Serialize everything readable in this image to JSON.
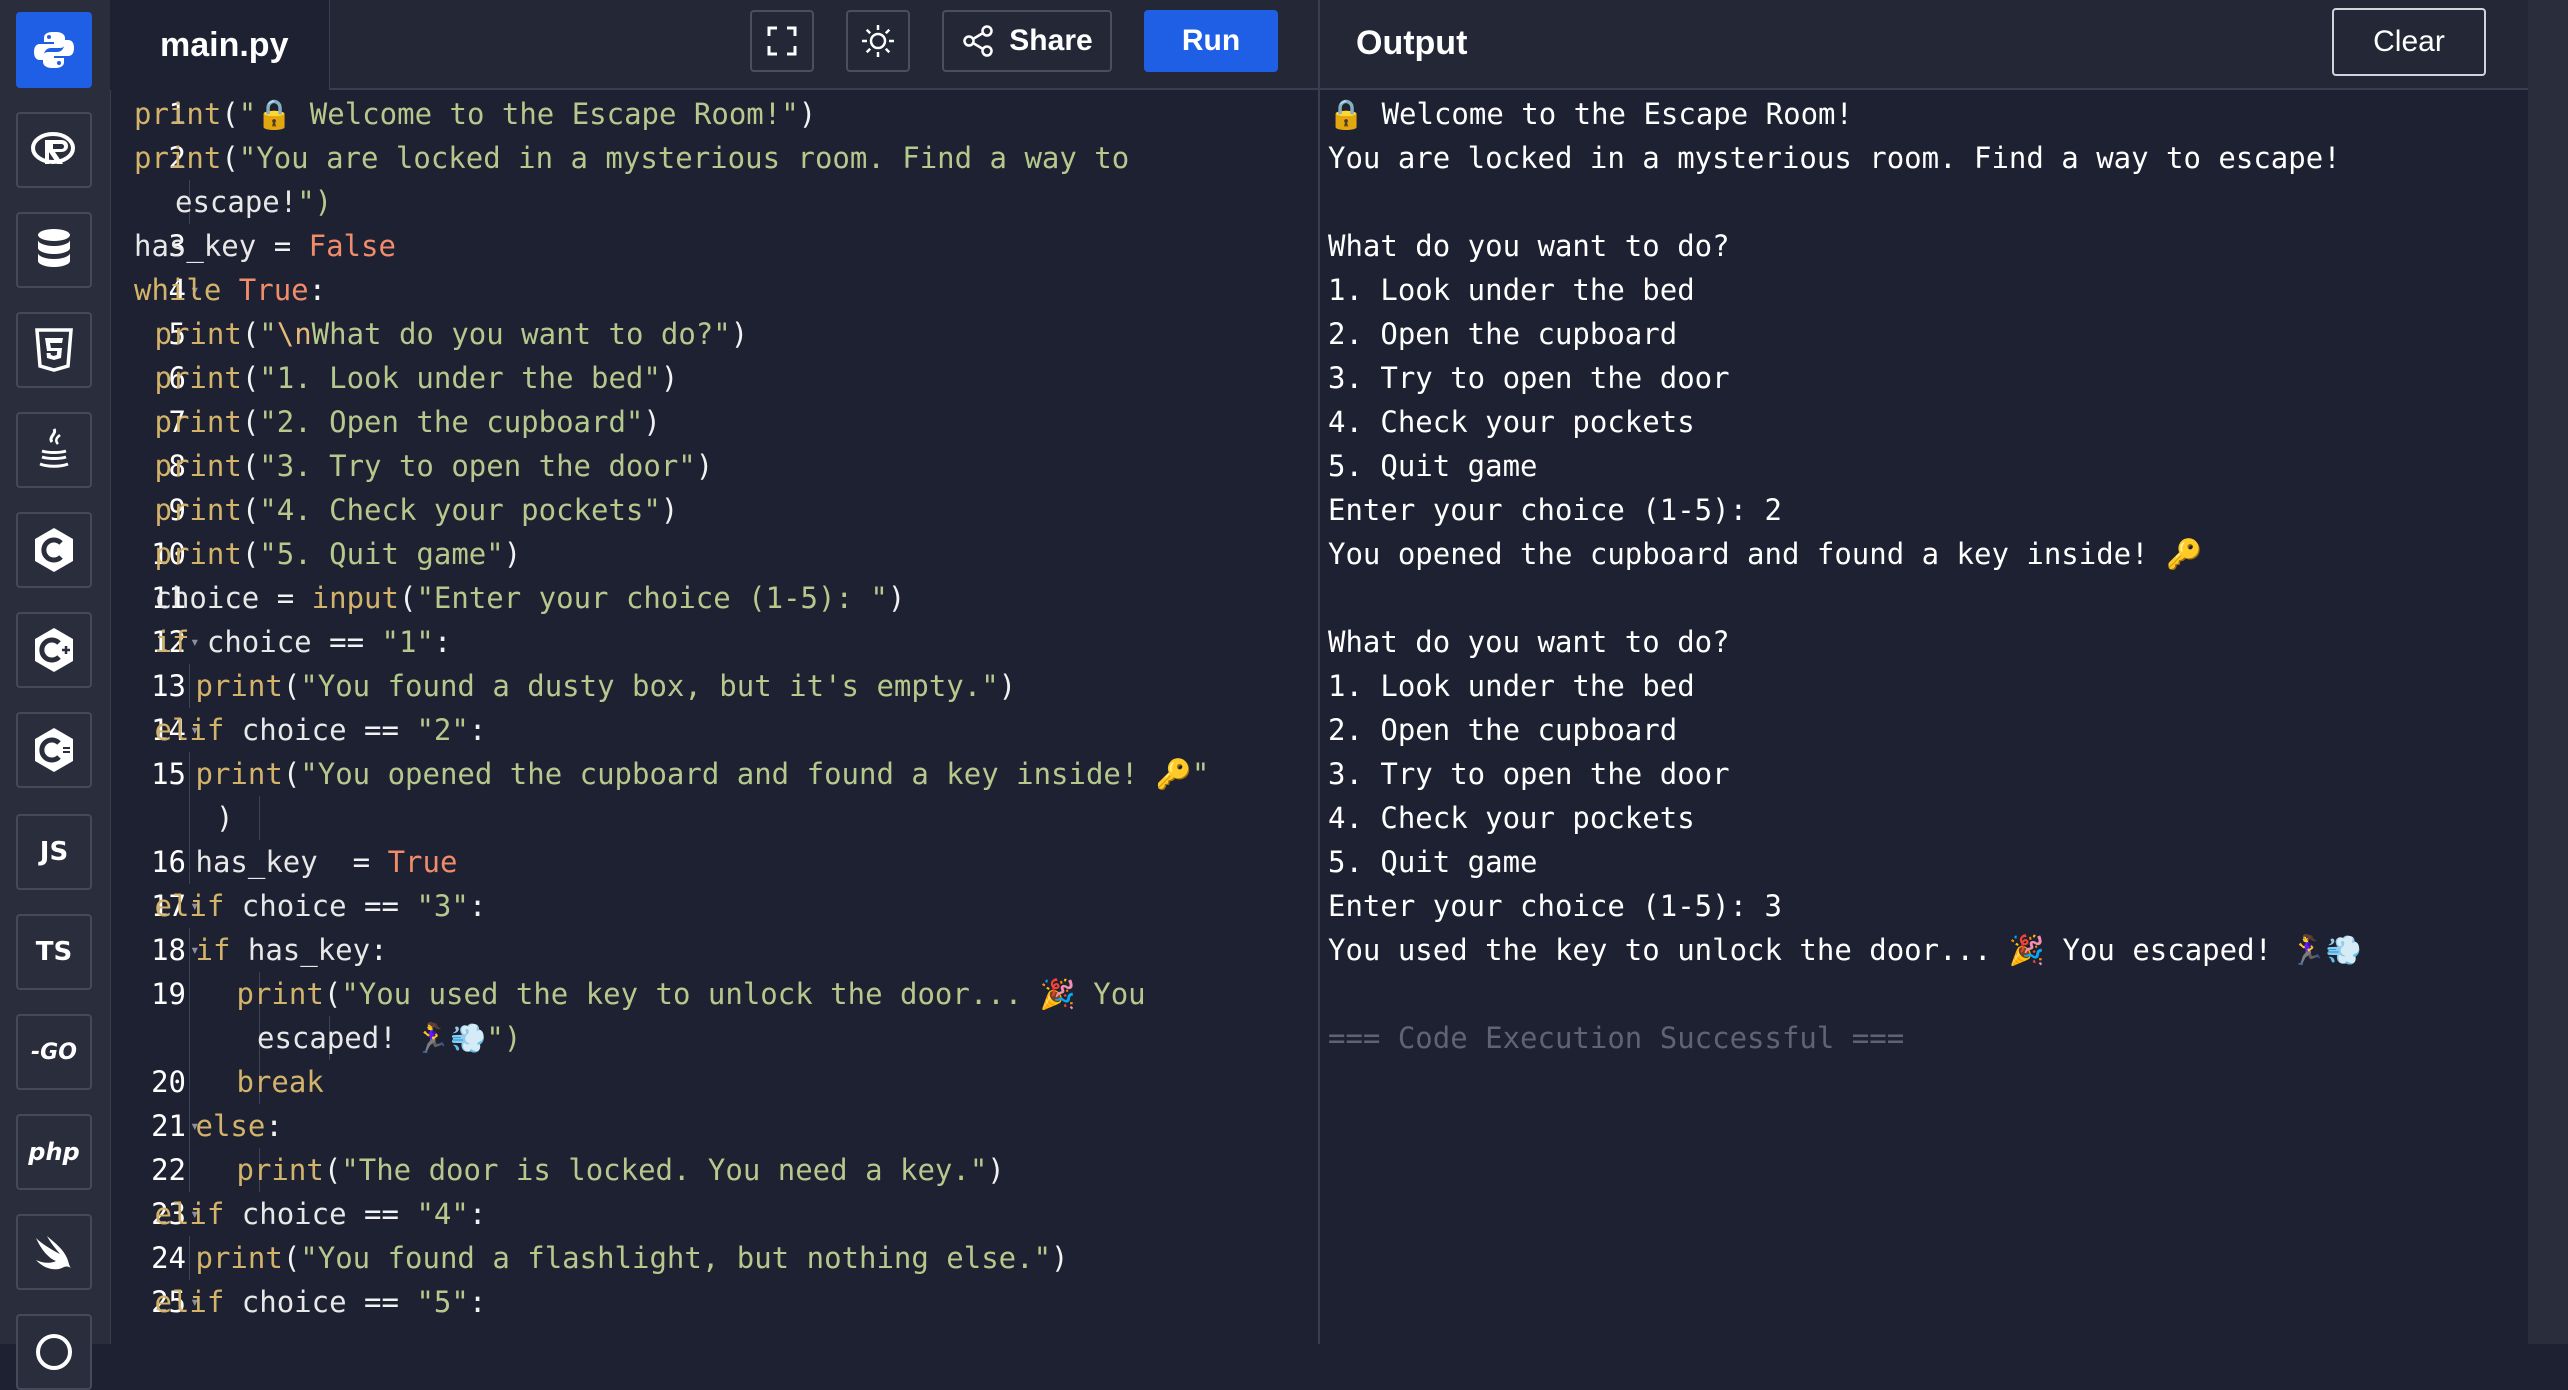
{
  "sidebar": {
    "items": [
      {
        "name": "python",
        "label": "",
        "icon": "python-icon"
      },
      {
        "name": "r",
        "label": "",
        "icon": "r-icon"
      },
      {
        "name": "sql",
        "label": "",
        "icon": "database-icon"
      },
      {
        "name": "html",
        "label": "",
        "icon": "html5-icon"
      },
      {
        "name": "java",
        "label": "",
        "icon": "java-icon"
      },
      {
        "name": "c",
        "label": "",
        "icon": "c-icon"
      },
      {
        "name": "cpp",
        "label": "",
        "icon": "cpp-icon"
      },
      {
        "name": "csharp",
        "label": "",
        "icon": "csharp-icon"
      },
      {
        "name": "js",
        "label": "JS",
        "icon": "js-icon"
      },
      {
        "name": "ts",
        "label": "TS",
        "icon": "ts-icon"
      },
      {
        "name": "go",
        "label": "-GO",
        "icon": "go-icon"
      },
      {
        "name": "php",
        "label": "php",
        "icon": "php-icon"
      },
      {
        "name": "swift",
        "label": "",
        "icon": "swift-icon"
      },
      {
        "name": "rust",
        "label": "",
        "icon": "rust-icon"
      }
    ]
  },
  "editor": {
    "file_name": "main.py",
    "toolbar": {
      "share_label": "Share",
      "run_label": "Run"
    },
    "lines": [
      {
        "n": "1",
        "text": "print(\"🔒 Welcome to the Escape Room!\")"
      },
      {
        "n": "2",
        "text": "print(\"You are locked in a mysterious room. Find a way to"
      },
      {
        "n": "",
        "text": "    escape!\")"
      },
      {
        "n": "3",
        "text": "has_key = False"
      },
      {
        "n": "4",
        "text": "while True:"
      },
      {
        "n": "5",
        "text": "  print(\"\\nWhat do you want to do?\")"
      },
      {
        "n": "6",
        "text": "  print(\"1. Look under the bed\")"
      },
      {
        "n": "7",
        "text": "  print(\"2. Open the cupboard\")"
      },
      {
        "n": "8",
        "text": "  print(\"3. Try to open the door\")"
      },
      {
        "n": "9",
        "text": "  print(\"4. Check your pockets\")"
      },
      {
        "n": "10",
        "text": "  print(\"5. Quit game\")"
      },
      {
        "n": "11",
        "text": "  choice = input(\"Enter your choice (1-5): \")"
      },
      {
        "n": "12",
        "text": "  if choice == \"1\":"
      },
      {
        "n": "13",
        "text": "      print(\"You found a dusty box, but it's empty.\")"
      },
      {
        "n": "14",
        "text": "  elif choice == \"2\":"
      },
      {
        "n": "15",
        "text": "      print(\"You opened the cupboard and found a key inside! 🔑\""
      },
      {
        "n": "",
        "text": "        )"
      },
      {
        "n": "16",
        "text": "      has_key  = True"
      },
      {
        "n": "17",
        "text": "  elif choice == \"3\":"
      },
      {
        "n": "18",
        "text": "      if has_key:"
      },
      {
        "n": "19",
        "text": "          print(\"You used the key to unlock the door... 🎉 You"
      },
      {
        "n": "",
        "text": "            escaped! 🏃‍♀️💨\")"
      },
      {
        "n": "20",
        "text": "          break"
      },
      {
        "n": "21",
        "text": "      else:"
      },
      {
        "n": "22",
        "text": "          print(\"The door is locked. You need a key.\")"
      },
      {
        "n": "23",
        "text": "  elif choice == \"4\":"
      },
      {
        "n": "24",
        "text": "      print(\"You found a flashlight, but nothing else.\")"
      },
      {
        "n": "25",
        "text": "  elif choice == \"5\":"
      }
    ]
  },
  "output": {
    "title": "Output",
    "clear_label": "Clear",
    "lines": [
      "🔒 Welcome to the Escape Room!",
      "You are locked in a mysterious room. Find a way to escape!",
      "",
      "What do you want to do?",
      "1. Look under the bed",
      "2. Open the cupboard",
      "3. Try to open the door",
      "4. Check your pockets",
      "5. Quit game",
      "Enter your choice (1-5): 2",
      "You opened the cupboard and found a key inside! 🔑",
      "",
      "What do you want to do?",
      "1. Look under the bed",
      "2. Open the cupboard",
      "3. Try to open the door",
      "4. Check your pockets",
      "5. Quit game",
      "Enter your choice (1-5): 3",
      "You used the key to unlock the door... 🎉 You escaped! 🏃‍♀️💨",
      "",
      "=== Code Execution Successful ==="
    ]
  },
  "colors": {
    "accent": "#1f5fe6",
    "background": "#1d2131",
    "keyword": "#d3b36a",
    "string": "#b5c98d",
    "constant": "#f08c6a"
  }
}
